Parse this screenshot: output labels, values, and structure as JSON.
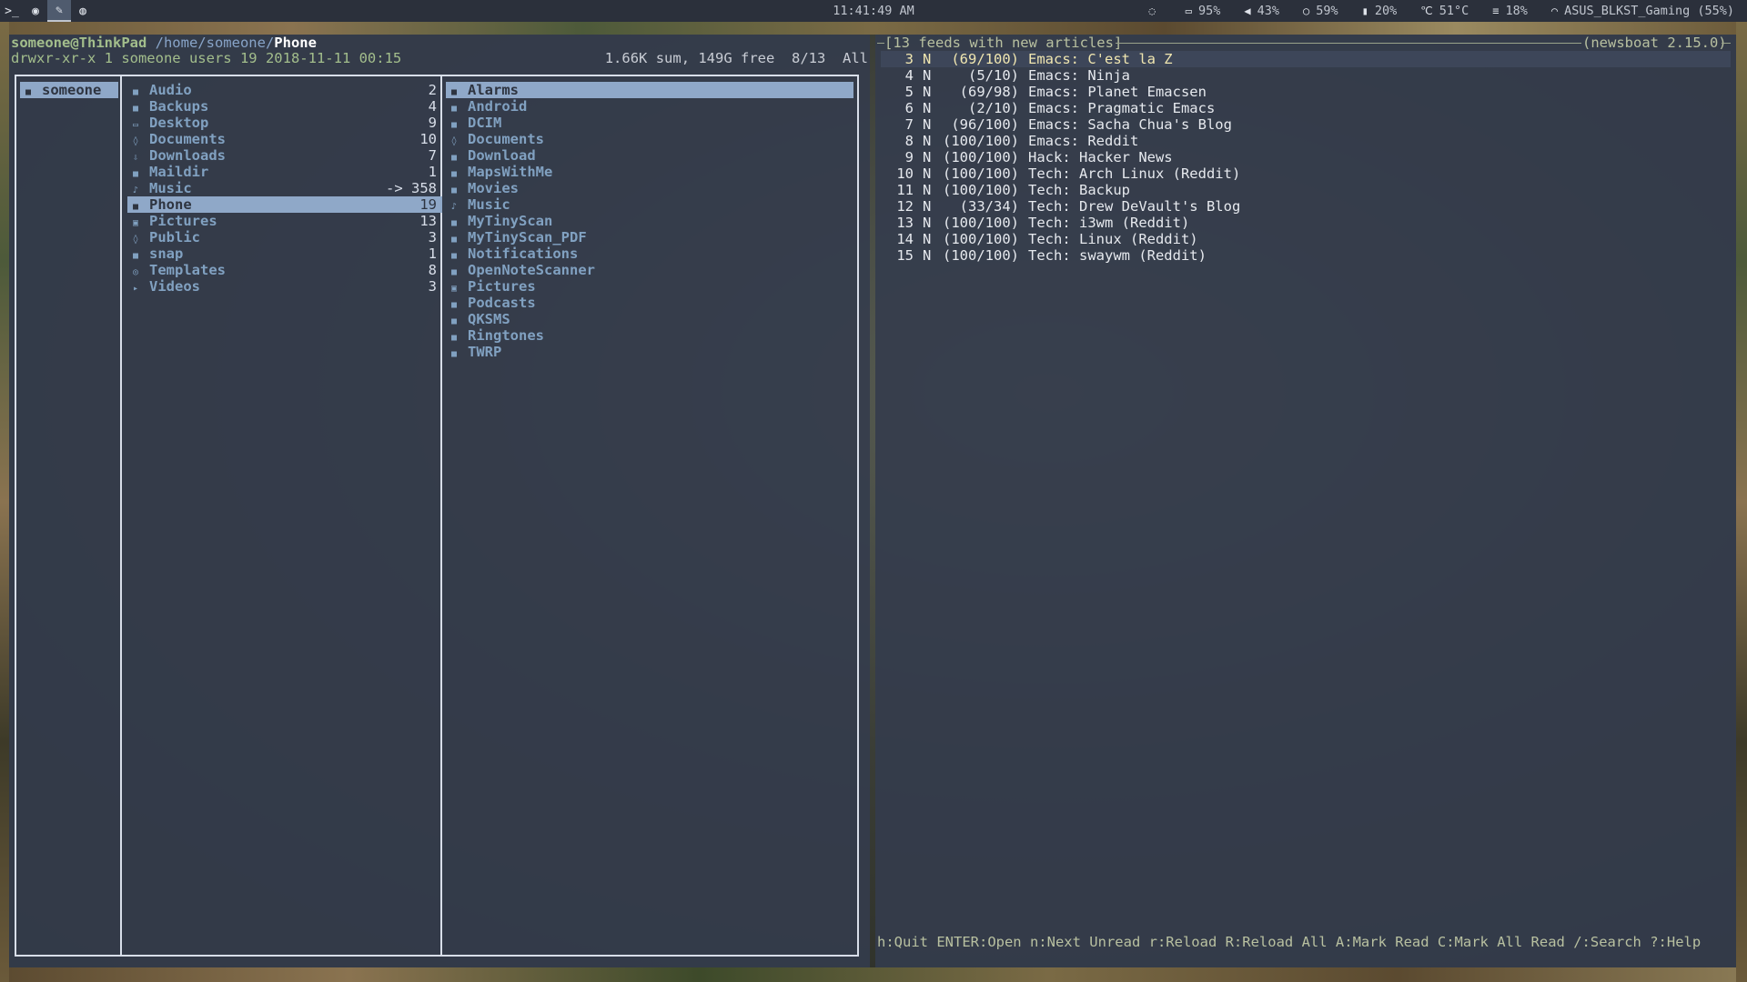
{
  "topbar": {
    "workspaces": [
      {
        "icon": "terminal-icon",
        "glyph": ">_"
      },
      {
        "icon": "firefox-icon",
        "glyph": "◉"
      },
      {
        "icon": "edit-icon",
        "glyph": "✎"
      },
      {
        "icon": "spotify-icon",
        "glyph": "◍"
      }
    ],
    "clock": "11:41:49 AM",
    "status": [
      {
        "icon": "eye-off-icon",
        "glyph": "◌",
        "text": ""
      },
      {
        "icon": "battery-icon",
        "glyph": "▭",
        "text": "95%"
      },
      {
        "icon": "volume-icon",
        "glyph": "◀",
        "text": "43%"
      },
      {
        "icon": "cpu-icon",
        "glyph": "○",
        "text": "59%"
      },
      {
        "icon": "memory-icon",
        "glyph": "▮",
        "text": "20%"
      },
      {
        "icon": "temperature-icon",
        "glyph": "℃",
        "text": "51°C"
      },
      {
        "icon": "disk-icon",
        "glyph": "≡",
        "text": "18%"
      },
      {
        "icon": "wifi-icon",
        "glyph": "◠",
        "text": "ASUS_BLKST_Gaming (55%)"
      }
    ]
  },
  "ranger": {
    "user_host": "someone@ThinkPad",
    "path_prefix": " /home/someone/",
    "path_current": "Phone",
    "file_info": "drwxr-xr-x 1 someone users 19 2018-11-11 00:15",
    "disk_info": "1.66K sum, 149G free  8/13  All",
    "parent_column": [
      {
        "name": "someone",
        "count": "",
        "icon": "folder-icon",
        "selected": true
      }
    ],
    "current_column": [
      {
        "name": "Audio",
        "count": "2",
        "icon": "folder-icon"
      },
      {
        "name": "Backups",
        "count": "4",
        "icon": "folder-icon"
      },
      {
        "name": "Desktop",
        "count": "9",
        "icon": "desktop-icon"
      },
      {
        "name": "Documents",
        "count": "10",
        "icon": "documents-icon"
      },
      {
        "name": "Downloads",
        "count": "7",
        "icon": "download-icon"
      },
      {
        "name": "Maildir",
        "count": "1",
        "icon": "folder-icon"
      },
      {
        "name": "Music",
        "count": "-> 358",
        "icon": "music-icon"
      },
      {
        "name": "Phone",
        "count": "19",
        "icon": "folder-icon",
        "selected": true
      },
      {
        "name": "Pictures",
        "count": "13",
        "icon": "pictures-icon"
      },
      {
        "name": "Public",
        "count": "3",
        "icon": "public-icon"
      },
      {
        "name": "snap",
        "count": "1",
        "icon": "folder-icon"
      },
      {
        "name": "Templates",
        "count": "8",
        "icon": "templates-icon"
      },
      {
        "name": "Videos",
        "count": "3",
        "icon": "videos-icon"
      }
    ],
    "preview_column": [
      {
        "name": "Alarms",
        "icon": "folder-icon",
        "selected": true
      },
      {
        "name": "Android",
        "icon": "folder-icon"
      },
      {
        "name": "DCIM",
        "icon": "folder-icon"
      },
      {
        "name": "Documents",
        "icon": "documents-icon"
      },
      {
        "name": "Download",
        "icon": "folder-icon"
      },
      {
        "name": "MapsWithMe",
        "icon": "folder-icon"
      },
      {
        "name": "Movies",
        "icon": "folder-icon"
      },
      {
        "name": "Music",
        "icon": "music-icon"
      },
      {
        "name": "MyTinyScan",
        "icon": "folder-icon"
      },
      {
        "name": "MyTinyScan_PDF",
        "icon": "folder-icon"
      },
      {
        "name": "Notifications",
        "icon": "folder-icon"
      },
      {
        "name": "OpenNoteScanner",
        "icon": "folder-icon"
      },
      {
        "name": "Pictures",
        "icon": "pictures-icon"
      },
      {
        "name": "Podcasts",
        "icon": "folder-icon"
      },
      {
        "name": "QKSMS",
        "icon": "folder-icon"
      },
      {
        "name": "Ringtones",
        "icon": "folder-icon"
      },
      {
        "name": "TWRP",
        "icon": "folder-icon"
      }
    ]
  },
  "newsboat": {
    "header_left": "[13 feeds with new articles]",
    "header_right": "(newsboat 2.15.0)",
    "feeds": [
      {
        "num": "3",
        "flag": "N",
        "count": "(69/100)",
        "title": "Emacs: C'est la Z",
        "selected": true
      },
      {
        "num": "4",
        "flag": "N",
        "count": "(5/10)",
        "title": "Emacs: Ninja"
      },
      {
        "num": "5",
        "flag": "N",
        "count": "(69/98)",
        "title": "Emacs: Planet Emacsen"
      },
      {
        "num": "6",
        "flag": "N",
        "count": "(2/10)",
        "title": "Emacs: Pragmatic Emacs"
      },
      {
        "num": "7",
        "flag": "N",
        "count": "(96/100)",
        "title": "Emacs: Sacha Chua's Blog"
      },
      {
        "num": "8",
        "flag": "N",
        "count": "(100/100)",
        "title": "Emacs: Reddit"
      },
      {
        "num": "9",
        "flag": "N",
        "count": "(100/100)",
        "title": "Hack: Hacker News"
      },
      {
        "num": "10",
        "flag": "N",
        "count": "(100/100)",
        "title": "Tech: Arch Linux (Reddit)"
      },
      {
        "num": "11",
        "flag": "N",
        "count": "(100/100)",
        "title": "Tech: Backup"
      },
      {
        "num": "12",
        "flag": "N",
        "count": "(33/34)",
        "title": "Tech: Drew DeVault's Blog"
      },
      {
        "num": "13",
        "flag": "N",
        "count": "(100/100)",
        "title": "Tech: i3wm (Reddit)"
      },
      {
        "num": "14",
        "flag": "N",
        "count": "(100/100)",
        "title": "Tech: Linux (Reddit)"
      },
      {
        "num": "15",
        "flag": "N",
        "count": "(100/100)",
        "title": "Tech: swaywm (Reddit)"
      }
    ],
    "footer": "h:Quit ENTER:Open n:Next Unread r:Reload R:Reload All A:Mark Read C:Mark All Read /:Search ?:Help"
  },
  "colors": {
    "selection": "#8fa8c8",
    "directory": "#81a1c1",
    "panel_bg": "#343c4c",
    "bar_bg": "#2b303b"
  }
}
